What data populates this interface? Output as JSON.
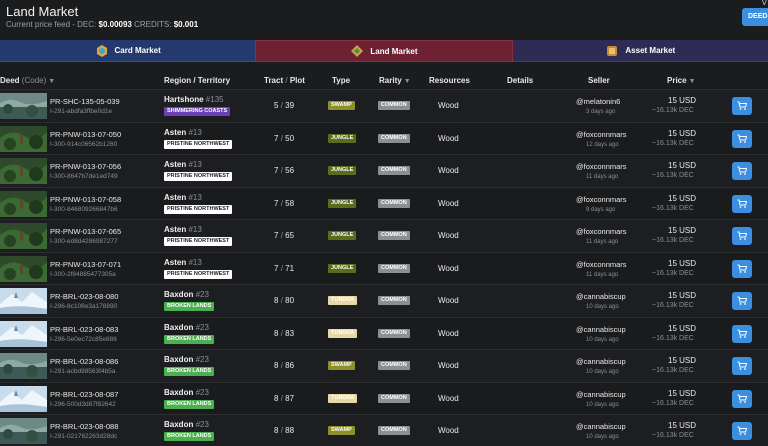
{
  "header": {
    "title": "Land Market",
    "feed_label": "Current price feed - DEC:",
    "dec_price": "$0.00093",
    "credits_label": "CREDITS:",
    "credits_price": "$0.001",
    "deeds_button": "DEEDS",
    "corner": "V"
  },
  "tabs": [
    {
      "label": "Card Market",
      "icon": "card-icon"
    },
    {
      "label": "Land Market",
      "icon": "land-icon",
      "active": true
    },
    {
      "label": "Asset Market",
      "icon": "scroll-icon"
    }
  ],
  "columns": {
    "deed": "Deed",
    "deed_sub": "(Code)",
    "region": "Region / Territory",
    "tract": "Tract",
    "plot": "Plot",
    "type": "Type",
    "rarity": "Rarity",
    "resources": "Resources",
    "details": "Details",
    "seller": "Seller",
    "price": "Price"
  },
  "colors": {
    "accent": "#3b8ee0",
    "swamp": "#8c8f2a",
    "jungle": "#5c6b1c",
    "tundra": "#e8d7a8",
    "shimmering": "#6b3fb8",
    "broken": "#4caf50",
    "pristine": "#ffffff"
  },
  "rows": [
    {
      "deed": "PR-SHC-135-05-039",
      "code": "I-291-abdfa3ffbe0d1e",
      "region": "Hartshone",
      "region_num": "#135",
      "territory": "SHIMMERING COASTS",
      "terr_style": "shimmering",
      "tract": "5",
      "plot": "39",
      "type": "SWAMP",
      "rarity": "COMMON",
      "resource": "Wood",
      "seller": "@melatonin6",
      "ago": "3 days ago",
      "usd": "15 USD",
      "dec": "~16.13k DEC",
      "thumb": "swamp"
    },
    {
      "deed": "PR-PNW-013-07-050",
      "code": "I-300-914c06562b1260",
      "region": "Asten",
      "region_num": "#13",
      "territory": "PRISTINE NORTHWEST",
      "terr_style": "pristine",
      "tract": "7",
      "plot": "50",
      "type": "JUNGLE",
      "rarity": "COMMON",
      "resource": "Wood",
      "seller": "@foxconnmars",
      "ago": "12 days ago",
      "usd": "15 USD",
      "dec": "~16.13k DEC",
      "thumb": "jungle"
    },
    {
      "deed": "PR-PNW-013-07-056",
      "code": "I-300-8647b7de1ed749",
      "region": "Asten",
      "region_num": "#13",
      "territory": "PRISTINE NORTHWEST",
      "terr_style": "pristine",
      "tract": "7",
      "plot": "56",
      "type": "JUNGLE",
      "rarity": "COMMON",
      "resource": "Wood",
      "seller": "@foxconnmars",
      "ago": "11 days ago",
      "usd": "15 USD",
      "dec": "~16.13k DEC",
      "thumb": "jungle"
    },
    {
      "deed": "PR-PNW-013-07-058",
      "code": "I-300-846809266847b6",
      "region": "Asten",
      "region_num": "#13",
      "territory": "PRISTINE NORTHWEST",
      "terr_style": "pristine",
      "tract": "7",
      "plot": "58",
      "type": "JUNGLE",
      "rarity": "COMMON",
      "resource": "Wood",
      "seller": "@foxconnmars",
      "ago": "9 days ago",
      "usd": "15 USD",
      "dec": "~16.13k DEC",
      "thumb": "jungle"
    },
    {
      "deed": "PR-PNW-013-07-065",
      "code": "I-300-ed8d4286987277",
      "region": "Asten",
      "region_num": "#13",
      "territory": "PRISTINE NORTHWEST",
      "terr_style": "pristine",
      "tract": "7",
      "plot": "65",
      "type": "JUNGLE",
      "rarity": "COMMON",
      "resource": "Wood",
      "seller": "@foxconnmars",
      "ago": "11 days ago",
      "usd": "15 USD",
      "dec": "~16.13k DEC",
      "thumb": "jungle"
    },
    {
      "deed": "PR-PNW-013-07-071",
      "code": "I-300-2f84885477305a",
      "region": "Asten",
      "region_num": "#13",
      "territory": "PRISTINE NORTHWEST",
      "terr_style": "pristine",
      "tract": "7",
      "plot": "71",
      "type": "JUNGLE",
      "rarity": "COMMON",
      "resource": "Wood",
      "seller": "@foxconnmars",
      "ago": "11 days ago",
      "usd": "15 USD",
      "dec": "~16.13k DEC",
      "thumb": "jungle"
    },
    {
      "deed": "PR-BRL-023-08-080",
      "code": "I-296-8c108e3a178890",
      "region": "Baxdon",
      "region_num": "#23",
      "territory": "BROKEN LANDS",
      "terr_style": "broken",
      "tract": "8",
      "plot": "80",
      "type": "TUNDRA",
      "rarity": "COMMON",
      "resource": "Wood",
      "seller": "@cannabiscup",
      "ago": "10 days ago",
      "usd": "15 USD",
      "dec": "~16.13k DEC",
      "thumb": "tundra"
    },
    {
      "deed": "PR-BRL-023-08-083",
      "code": "I-296-5e0ec72c85e886",
      "region": "Baxdon",
      "region_num": "#23",
      "territory": "BROKEN LANDS",
      "terr_style": "broken",
      "tract": "8",
      "plot": "83",
      "type": "TUNDRA",
      "rarity": "COMMON",
      "resource": "Wood",
      "seller": "@cannabiscup",
      "ago": "10 days ago",
      "usd": "15 USD",
      "dec": "~16.13k DEC",
      "thumb": "tundra"
    },
    {
      "deed": "PR-BRL-023-08-086",
      "code": "I-291-acbd98563f4b5a",
      "region": "Baxdon",
      "region_num": "#23",
      "territory": "BROKEN LANDS",
      "terr_style": "broken",
      "tract": "8",
      "plot": "86",
      "type": "SWAMP",
      "rarity": "COMMON",
      "resource": "Wood",
      "seller": "@cannabiscup",
      "ago": "10 days ago",
      "usd": "15 USD",
      "dec": "~16.13k DEC",
      "thumb": "swamp"
    },
    {
      "deed": "PR-BRL-023-08-087",
      "code": "I-296-500d3d87f82642",
      "region": "Baxdon",
      "region_num": "#23",
      "territory": "BROKEN LANDS",
      "terr_style": "broken",
      "tract": "8",
      "plot": "87",
      "type": "TUNDRA",
      "rarity": "COMMON",
      "resource": "Wood",
      "seller": "@cannabiscup",
      "ago": "10 days ago",
      "usd": "15 USD",
      "dec": "~16.13k DEC",
      "thumb": "tundra"
    },
    {
      "deed": "PR-BRL-023-08-088",
      "code": "I-291-021762263d28dc",
      "region": "Baxdon",
      "region_num": "#23",
      "territory": "BROKEN LANDS",
      "terr_style": "broken",
      "tract": "8",
      "plot": "88",
      "type": "SWAMP",
      "rarity": "COMMON",
      "resource": "Wood",
      "seller": "@cannabiscup",
      "ago": "10 days ago",
      "usd": "15 USD",
      "dec": "~16.13k DEC",
      "thumb": "swamp"
    }
  ]
}
